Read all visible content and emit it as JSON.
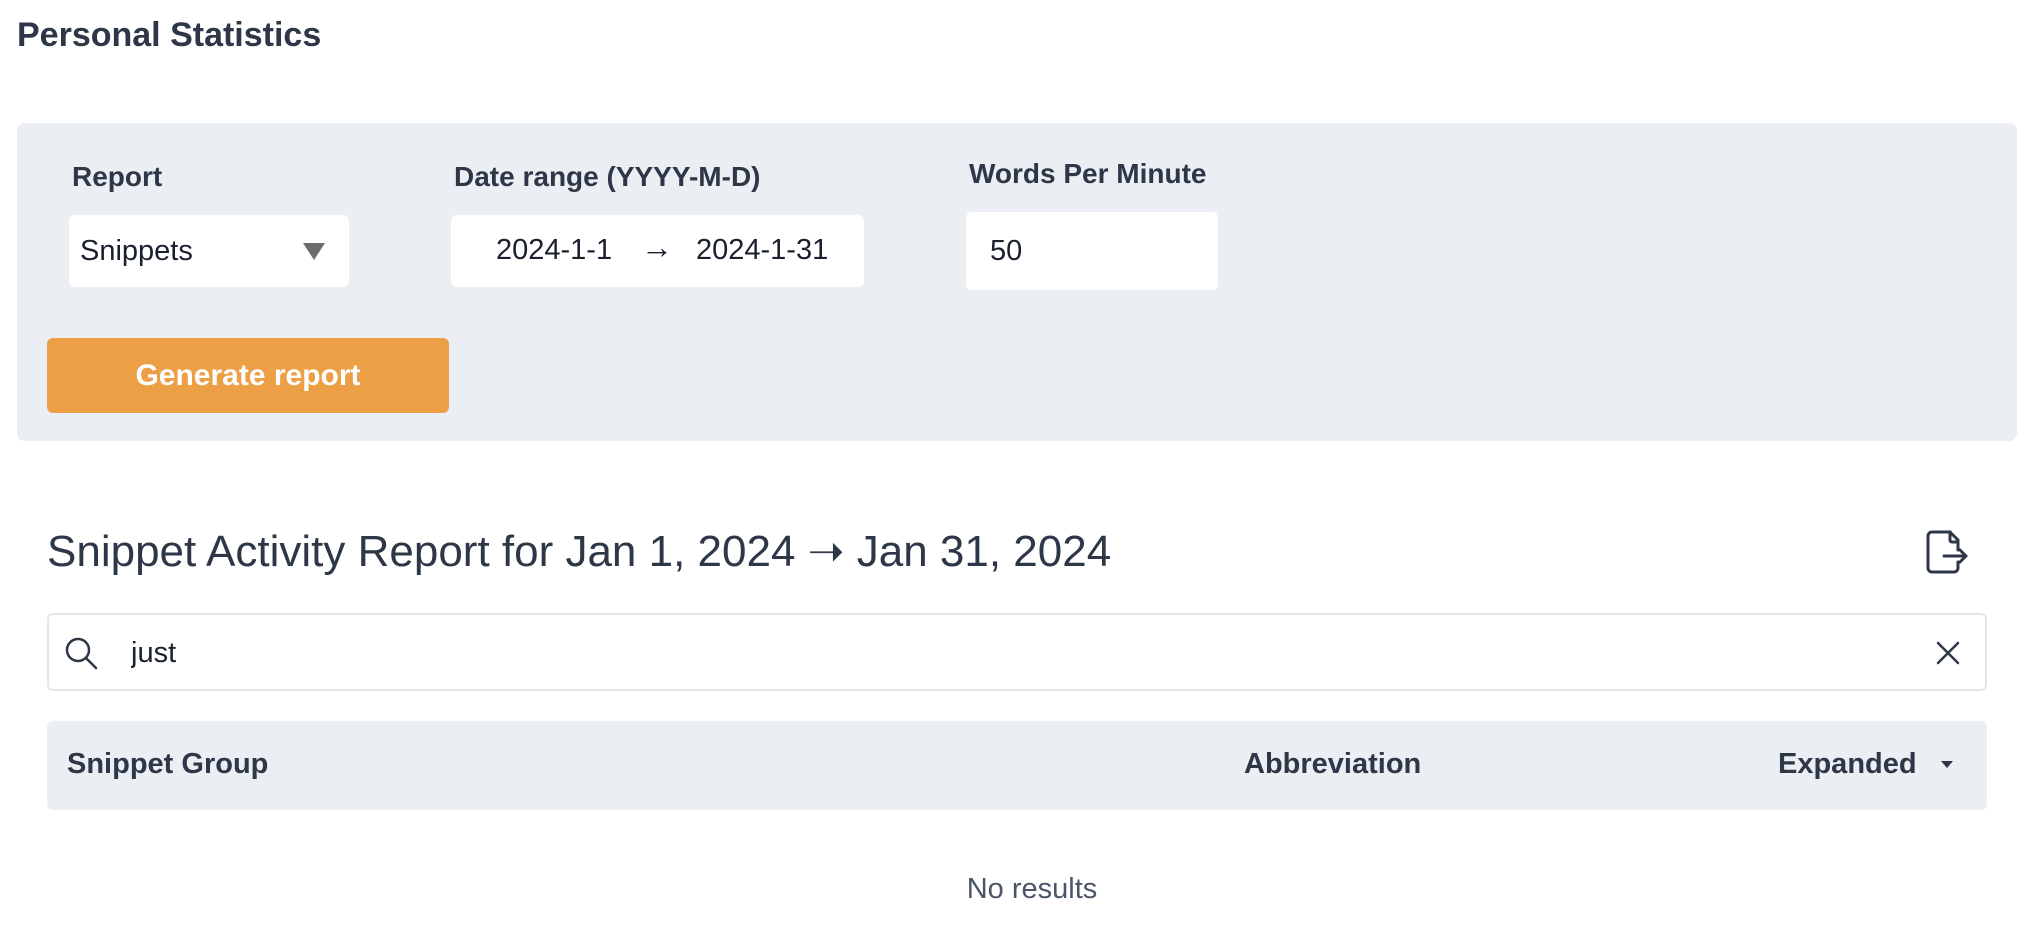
{
  "page": {
    "title": "Personal Statistics"
  },
  "filters": {
    "report_label": "Report",
    "report_value": "Snippets",
    "date_range_label": "Date range (YYYY-M-D)",
    "date_start": "2024-1-1",
    "date_arrow": "→",
    "date_end": "2024-1-31",
    "wpm_label": "Words Per Minute",
    "wpm_value": "50",
    "generate_label": "Generate report"
  },
  "report": {
    "title": "Snippet Activity Report for Jan 1, 2024 ➝ Jan 31, 2024",
    "export_icon": "export-icon"
  },
  "search": {
    "value": "just",
    "icon": "search-icon",
    "clear_icon": "close-icon"
  },
  "table": {
    "columns": [
      "Snippet Group",
      "Abbreviation",
      "Expanded"
    ],
    "rows": [],
    "empty_text": "No results"
  },
  "colors": {
    "panel_background": "#ebeef3",
    "accent": "#ec9f45",
    "text": "#2d3748"
  }
}
